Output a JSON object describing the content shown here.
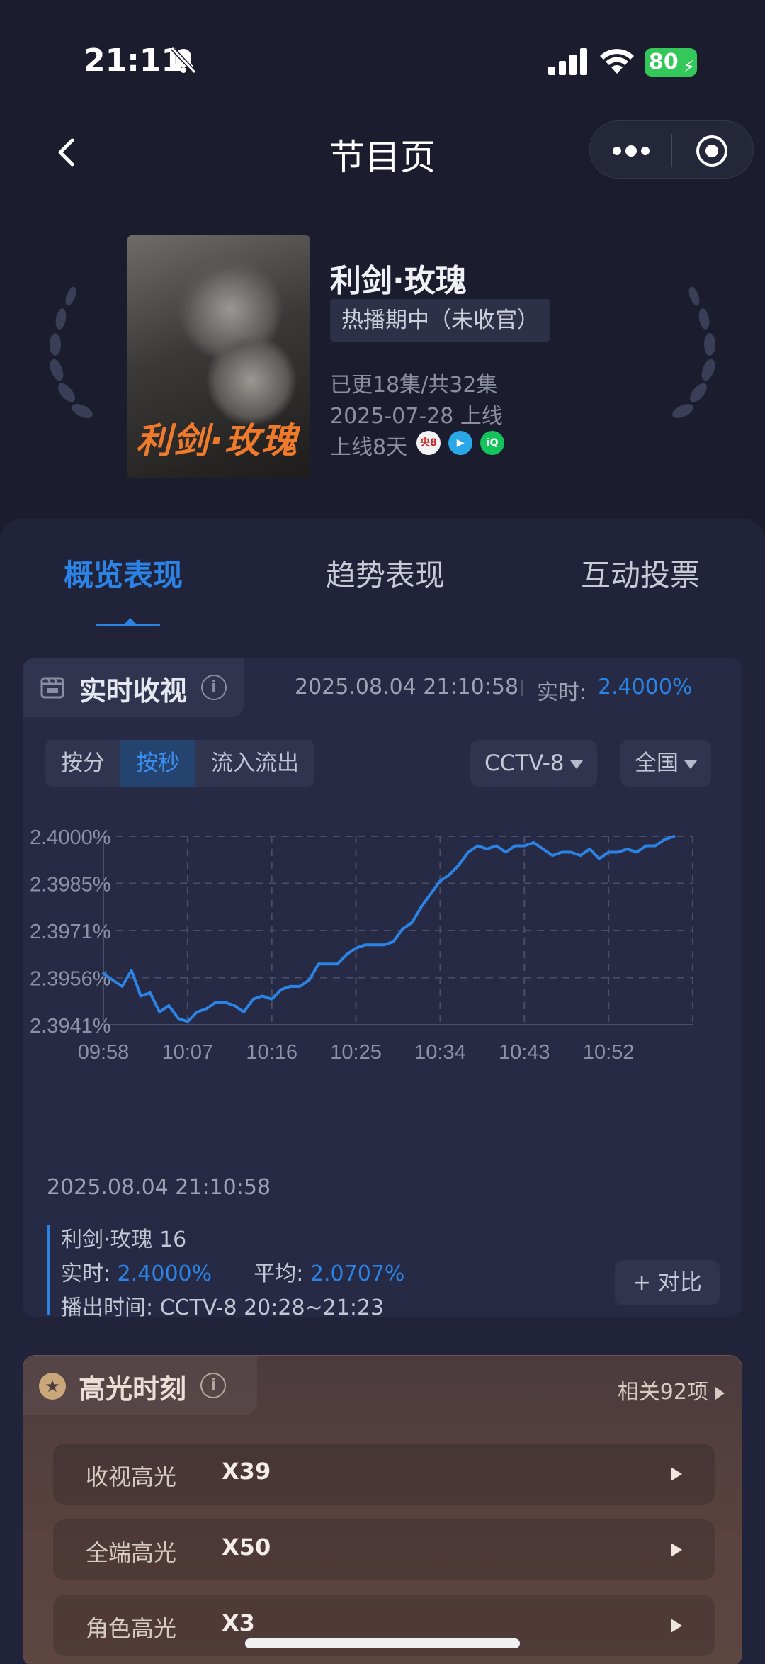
{
  "status_bar": {
    "time": "21:11",
    "battery": "80"
  },
  "nav": {
    "title": "节目页"
  },
  "show": {
    "name": "利剑·玫瑰",
    "status": "热播期中（未收官）",
    "episodes": "已更18集/共32集",
    "premiere": "2025-07-28 上线",
    "days_online": "上线8天",
    "poster_title": "利剑·玫瑰",
    "platforms": [
      "央8",
      "腾讯视频",
      "爱奇艺"
    ]
  },
  "tabs": [
    "概览表现",
    "趋势表现",
    "互动投票"
  ],
  "realtime": {
    "title": "实时收视",
    "timestamp": "2025.08.04 21:10:58",
    "label": "实时:",
    "value": "2.4000%",
    "segments": [
      "按分",
      "按秒",
      "流入流出"
    ],
    "channel": "CCTV-8",
    "region": "全国",
    "compare_label": "+ 对比",
    "detail": {
      "time": "2025.08.04 21:10:58",
      "episode": "利剑·玫瑰 16",
      "realtime_label": "实时:",
      "realtime_value": "2.4000%",
      "avg_label": "平均:",
      "avg_value": "2.0707%",
      "airtime_label": "播出时间:",
      "airtime_value": "CCTV-8 20:28~21:23"
    }
  },
  "chart_data": {
    "type": "line",
    "x_ticks": [
      "09:58",
      "10:07",
      "10:16",
      "10:25",
      "10:34",
      "10:43",
      "10:52"
    ],
    "y_ticks": [
      "2.4000%",
      "2.3985%",
      "2.3971%",
      "2.3956%",
      "2.3941%"
    ],
    "ylim": [
      2.3941,
      2.4
    ],
    "grid": true,
    "color": "#2c83e6",
    "series": [
      {
        "x": [
          "09:58",
          "09:59",
          "10:00",
          "10:01",
          "10:02",
          "10:03",
          "10:04",
          "10:05",
          "10:06",
          "10:07",
          "10:08",
          "10:09",
          "10:10",
          "10:11",
          "10:12",
          "10:13",
          "10:14",
          "10:15",
          "10:16",
          "10:17",
          "10:18",
          "10:19",
          "10:20",
          "10:21",
          "10:22",
          "10:23",
          "10:24",
          "10:25",
          "10:26",
          "10:27",
          "10:28",
          "10:29",
          "10:30",
          "10:31",
          "10:32",
          "10:33",
          "10:34",
          "10:35",
          "10:36",
          "10:37",
          "10:38",
          "10:39",
          "10:40",
          "10:41",
          "10:42",
          "10:43",
          "10:44",
          "10:45",
          "10:46",
          "10:47",
          "10:48",
          "10:49",
          "10:50",
          "10:51",
          "10:52",
          "10:53",
          "10:54",
          "10:55",
          "10:56",
          "10:57",
          "10:58",
          "10:59"
        ],
        "values": [
          2.3957,
          2.3955,
          2.3953,
          2.3958,
          2.395,
          2.3951,
          2.3945,
          2.3947,
          2.3943,
          2.3942,
          2.3945,
          2.3946,
          2.3948,
          2.3948,
          2.3947,
          2.3945,
          2.3949,
          2.395,
          2.3949,
          2.3952,
          2.3953,
          2.3953,
          2.3955,
          2.396,
          2.396,
          2.396,
          2.3963,
          2.3965,
          2.3966,
          2.3966,
          2.3966,
          2.3967,
          2.3971,
          2.3973,
          2.3978,
          2.3982,
          2.3986,
          2.3988,
          2.3991,
          2.3995,
          2.3997,
          2.3996,
          2.3997,
          2.3995,
          2.3997,
          2.3997,
          2.3998,
          2.3996,
          2.3994,
          2.3995,
          2.3995,
          2.3994,
          2.3996,
          2.3993,
          2.3995,
          2.3995,
          2.3996,
          2.3995,
          2.3997,
          2.3997,
          2.3999,
          2.4
        ]
      }
    ]
  },
  "highlights": {
    "title": "高光时刻",
    "related": "相关92项",
    "rows": [
      {
        "label": "收视高光",
        "count": "X39"
      },
      {
        "label": "全端高光",
        "count": "X50"
      },
      {
        "label": "角色高光",
        "count": "X3"
      }
    ]
  }
}
